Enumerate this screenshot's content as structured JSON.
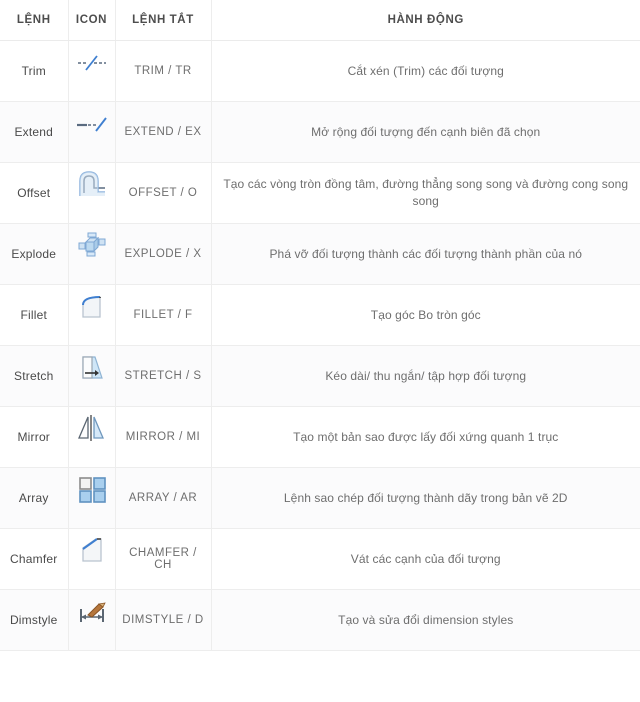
{
  "table": {
    "headers": [
      {
        "label": "LỆNH",
        "name": "header-command"
      },
      {
        "label": "ICON",
        "name": "header-icon"
      },
      {
        "label": "LỆNH TẮT",
        "name": "header-shortcut"
      },
      {
        "label": "HÀNH ĐỘNG",
        "name": "header-action"
      }
    ],
    "rows": [
      {
        "command": "Trim",
        "icon": "trim-icon",
        "shortcut": "TRIM / TR",
        "action": "Cắt xén (Trim) các đối tượng"
      },
      {
        "command": "Extend",
        "icon": "extend-icon",
        "shortcut": "EXTEND / EX",
        "action": "Mở rộng đối tượng đến cạnh biên đã chọn"
      },
      {
        "command": "Offset",
        "icon": "offset-icon",
        "shortcut": "OFFSET / O",
        "action": "Tạo các vòng tròn đồng tâm, đường thẳng song song và đường cong song song"
      },
      {
        "command": "Explode",
        "icon": "explode-icon",
        "shortcut": "EXPLODE / X",
        "action": "Phá vỡ đối tượng thành các đối tượng thành phần của nó"
      },
      {
        "command": "Fillet",
        "icon": "fillet-icon",
        "shortcut": "FILLET / F",
        "action": "Tạo góc Bo tròn góc"
      },
      {
        "command": "Stretch",
        "icon": "stretch-icon",
        "shortcut": "STRETCH / S",
        "action": "Kéo dài/ thu ngắn/ tập hợp đối tượng"
      },
      {
        "command": "Mirror",
        "icon": "mirror-icon",
        "shortcut": "MIRROR / MI",
        "action": "Tạo một bản sao được lấy đối xứng quanh 1 trục"
      },
      {
        "command": "Array",
        "icon": "array-icon",
        "shortcut": "ARRAY / AR",
        "action": "Lệnh sao chép đối tượng thành dãy trong bản vẽ 2D"
      },
      {
        "command": "Chamfer",
        "icon": "chamfer-icon",
        "shortcut": "CHAMFER / CH",
        "action": "Vát các cạnh của đối tượng"
      },
      {
        "command": "Dimstyle",
        "icon": "dimstyle-icon",
        "shortcut": "DIMSTYLE / D",
        "action": "Tạo và sửa đổi dimension styles"
      }
    ]
  },
  "colors": {
    "icon_blue": "#3f7fd0",
    "icon_fill_light": "#cfe2f3",
    "icon_outline": "#5a6b80",
    "border": "#ededed",
    "text": "#6e6e6e",
    "header_text": "#4d4d4d",
    "row_alt_bg": "#fbfbfc",
    "background": "#ffffff"
  }
}
